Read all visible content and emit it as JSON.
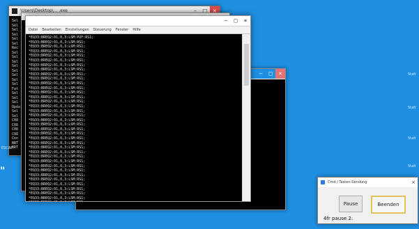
{
  "desktop": {
    "background": "#1e8fe1"
  },
  "windows": {
    "back": {
      "title": "\\Users\\Desktop\\... .exe",
      "side_lines": [
        "Sel",
        "Sel",
        "Sel",
        "Sel",
        "Sel",
        "Sel",
        "Rec",
        "Sel",
        "Sel",
        "Sel",
        "Sel",
        "Sel",
        "Sel",
        "Sel",
        "Sel",
        "Fat",
        "Sel",
        "Sel",
        "Sel",
        "Upda",
        "Sel",
        "Sel",
        "C08",
        "C08",
        "C08",
        "C08",
        "Con",
        "BRT",
        "BRT"
      ]
    },
    "front": {
      "menu": [
        "Datei",
        "Bearbeiten",
        "Einstellungen",
        "Steuerung",
        "Fenster",
        "Hilfe"
      ],
      "lines": [
        "*EQ33:BREQ2:01,0,3:LSM:PUF:RS1;",
        "*EQ33:BREQ2:01,0,3:LSM:RS1;",
        "*EQ33:BREQ2:01,0,3:LSM:RS1;",
        "*EQ33:BREQ2:01,0,3:LSM:RS1;",
        "*EQ33:BREQ2:01,0,3:LSM:RS1;",
        "*EQ33:BREQ2:01,0,3:LSM:RS1;",
        "*EQ33:BREQ2:01,0,3:LSM:RS1;",
        "*EQ33:BREQ2:01,0,3:LSM:RS1;",
        "*EQ33:BREQ2:01,0,3:LSM:RS1;",
        "*EQ33:BREQ2:01,0,3:LSM:RS1;",
        "*EQ33:BREQ2:01,0,3:LSM:RS1;",
        "*EQ33:BREQ2:01,0,3:LSM:RS1;",
        "*EQ33:BREQ2:01,0,3:LSM:RS1;",
        "*EQ33:BREQ2:01,0,3:LSM:RS1;",
        "*EQ33:BREQ2:01,0,3:LSM:RS1;",
        "*EQ33:BREQ2:01,0,3:LSM:RS1;",
        "*EQ33:BREQ2:01,0,3:LSM:RS1;",
        "*EQ33:BREQ2:01,0,3:LSM:RS1;",
        "*EQ33:BREQ2:01,0,3:LSM:RS1;",
        "*EQ33:BREQ2:01,0,3:LSM:RS1;",
        "*EQ33:BREQ2:01,0,3:LSM:RS1;",
        "*EQ33:BREQ2:01,0,3:LSM:RS1;",
        "*EQ33:BREQ2:01,0,3:LSM:RS1;",
        "*EQ33:BREQ2:01,0,3:LSM:RS1;",
        "*EQ33:BREQ2:01,0,3:LSM:RS1;",
        "*EQ33:BREQ2:01,0,3:LSM:RS1;",
        "*EQ33:BREQ2:01,0,3:LSM:RS1;",
        "*EQ33:BREQ2:01,0,3:LSM:RS1;",
        "*EQ33:BREQ2:01,0,3:LSM:RS1;",
        "*EQ33:BREQ2:01,0,3:LSM:RS1;",
        "*EQ33:BREQ2:01,0,3:LSM:RS1;",
        "*EQ33:BREQ2:01,0,3:LSM:RS1;",
        "*EQ33:BREQ2:01,0,3:LSM:RS1;",
        "*EQ33:BREQ2:01,0,3:LSM:RS1;",
        "*EQ33:BREQ2:01,0,3:LSM:RS1;",
        "*EQ33:BREQ2:01,0,3:LSM:RS1;",
        "*EQ33:BREQ2:01,0,3:LSM:RS1;"
      ]
    }
  },
  "desktop_labels": {
    "right": [
      "Stati",
      "Stati",
      "Stati",
      "Stati"
    ],
    "left": "ESCAP",
    "quote": "\""
  },
  "dialog": {
    "title": "Cmd / Tasten-Sendung",
    "pause_label": "Pause",
    "quit_label": "Beenden",
    "status": "4fr pause 2:"
  }
}
